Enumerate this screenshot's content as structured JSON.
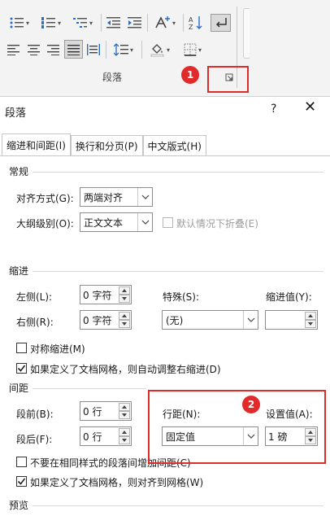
{
  "ribbon": {
    "group_label": "段落",
    "badge_1": "1"
  },
  "dialog": {
    "title": "段落",
    "help": "?",
    "close": "✕",
    "badge_2": "2",
    "tabs": [
      {
        "label": "缩进和间距(I)"
      },
      {
        "label": "换行和分页(P)"
      },
      {
        "label": "中文版式(H)"
      }
    ],
    "general": {
      "heading": "常规",
      "alignment_label": "对齐方式(G):",
      "alignment_value": "两端对齐",
      "outline_label": "大纲级别(O):",
      "outline_value": "正文文本",
      "collapse_label": "默认情况下折叠(E)"
    },
    "indent": {
      "heading": "缩进",
      "left_label": "左侧(L):",
      "left_value": "0 字符",
      "right_label": "右侧(R):",
      "right_value": "0 字符",
      "special_label": "特殊(S):",
      "special_value": "(无)",
      "by_label": "缩进值(Y):",
      "by_value": "",
      "mirror_label": "对称缩进(M)",
      "auto_adjust_label": "如果定义了文档网格，则自动调整右缩进(D)"
    },
    "spacing": {
      "heading": "间距",
      "before_label": "段前(B):",
      "before_value": "0 行",
      "after_label": "段后(F):",
      "after_value": "0 行",
      "line_spacing_label": "行距(N):",
      "line_spacing_value": "固定值",
      "at_label": "设置值(A):",
      "at_value": "1 磅",
      "no_space_same_style_label": "不要在相同样式的段落间增加间距(C)",
      "snap_grid_label": "如果定义了文档网格，则对齐到网格(W)"
    },
    "preview": {
      "heading": "预览"
    }
  },
  "colors": {
    "highlight": "#e12a2a",
    "ribbon_bg": "#f3f3f3"
  }
}
